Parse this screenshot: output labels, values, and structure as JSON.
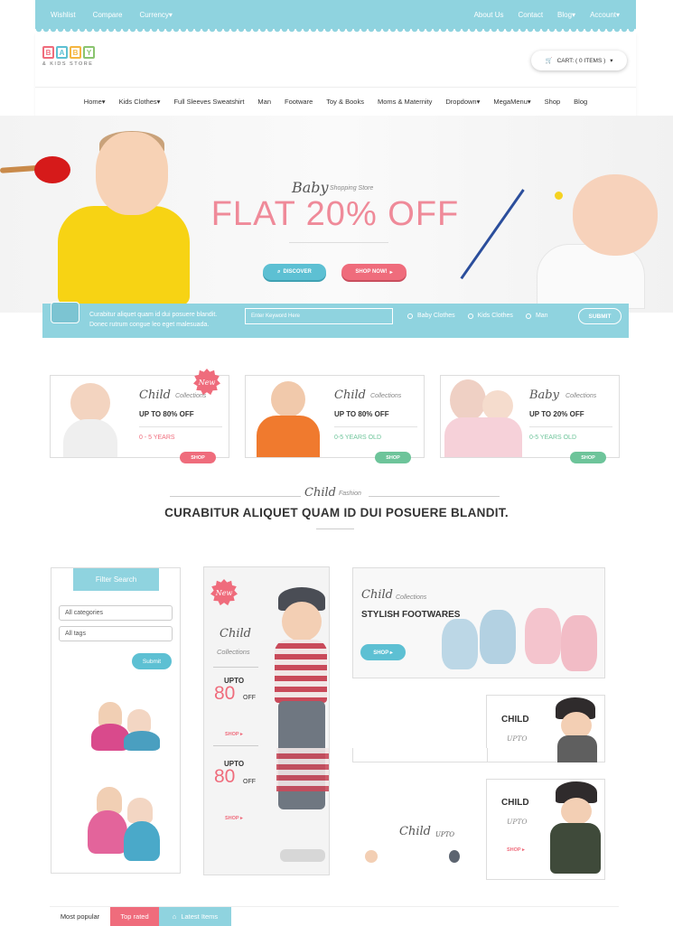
{
  "topbar": {
    "left": [
      "Wishlist",
      "Compare",
      "Currency▾"
    ],
    "right": [
      "About Us",
      "Contact",
      "Blog▾",
      "Account▾"
    ]
  },
  "logo": {
    "letters": [
      "B",
      "A",
      "B",
      "Y"
    ],
    "subtitle": "& KIDS STORE",
    "colors": [
      "#ef6c7c",
      "#5dc0d3",
      "#f5b640",
      "#8ac46f"
    ]
  },
  "cart": {
    "label": "CART: ( 0 ITEMS )",
    "icon": "cart-icon"
  },
  "nav": [
    "Home▾",
    "Kids Clothes▾",
    "Full Sleeves Sweatshirt",
    "Man",
    "Footware",
    "Toy & Books",
    "Moms & Maternity",
    "Dropdown▾",
    "MegaMenu▾",
    "Shop",
    "Blog"
  ],
  "hero": {
    "script": "Baby",
    "store": "Shopping Store",
    "title": "FLAT 20% OFF",
    "discover": "DISCOVER",
    "shop_now": "SHOP NOW!"
  },
  "search": {
    "text1": "Curabitur aliquet quam id dui posuere blandit.",
    "text2": "Donec rutrum congue leo eget malesuada.",
    "placeholder": "Enter Keyword Here",
    "options": [
      "Baby Clothes",
      "Kids Clothes",
      "Man"
    ],
    "submit": "SUBMIT"
  },
  "promos": [
    {
      "script": "Child",
      "collections": "Collections",
      "offer": "UP TO 80% OFF",
      "age": "0 - 5 YEARS",
      "btn": "SHOP",
      "badge": "New"
    },
    {
      "script": "Child",
      "collections": "Collections",
      "offer": "UP TO 80% OFF",
      "age": "0-5 YEARS OLD",
      "btn": "SHOP"
    },
    {
      "script": "Baby",
      "collections": "Collections",
      "offer": "UP TO 20% OFF",
      "age": "0-5 YEARS OLD",
      "btn": "SHOP"
    }
  ],
  "section": {
    "script": "Child",
    "sub": "Fashion",
    "title": "CURABITUR ALIQUET QUAM ID DUI POSUERE BLANDIT."
  },
  "filter": {
    "title": "Filter Search",
    "categories": "All categories",
    "tags": "All tags",
    "submit": "Submit"
  },
  "tall": {
    "badge": "New",
    "script": "Child",
    "collections": "Collections",
    "upto": "UPTO",
    "num": "80",
    "off": "OFF",
    "shop": "SHOP ▸"
  },
  "footwear": {
    "script": "Child",
    "collections": "Collections",
    "title": "STYLISH FOOTWARES",
    "btn": "SHOP ▸"
  },
  "child_boxes": [
    {
      "title": "CHILD",
      "upto": "UPTO"
    },
    {
      "title": "CHILD",
      "upto": "UPTO",
      "shop": "SHOP ▸"
    }
  ],
  "mini": {
    "script": "Child",
    "upto": "UPTO"
  },
  "tabs": [
    "Most popular",
    "Top rated",
    "Latest Items"
  ],
  "colors": {
    "blue": "#8fd3df",
    "blue_dark": "#5dc0d3",
    "pink": "#ef6c7c",
    "green": "#6dc49a"
  }
}
